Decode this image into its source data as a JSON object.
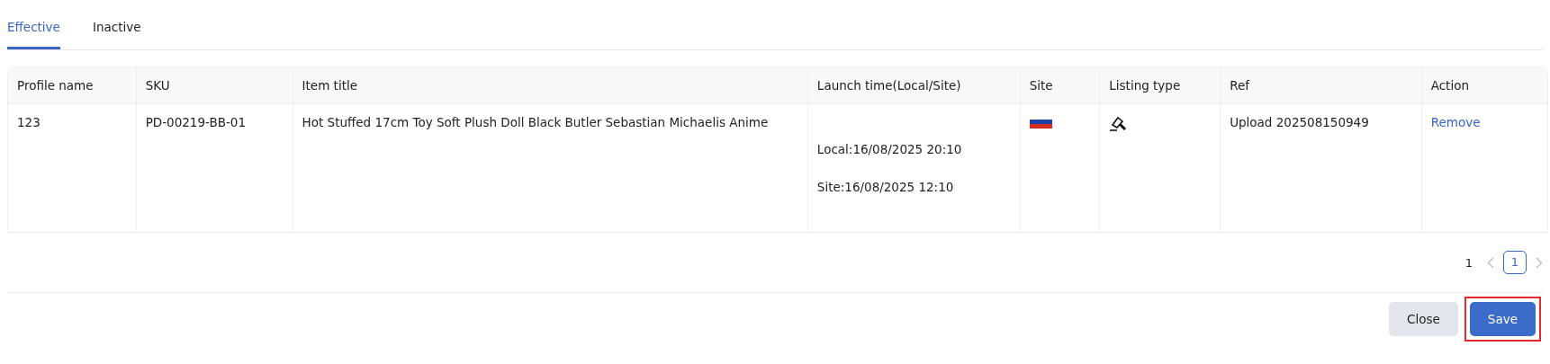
{
  "tabs": [
    {
      "label": "Effective",
      "selected": true
    },
    {
      "label": "Inactive",
      "selected": false
    }
  ],
  "table": {
    "columns": [
      "Profile name",
      "SKU",
      "Item title",
      "Launch time(Local/Site)",
      "Site",
      "Listing type",
      "Ref",
      "Action"
    ],
    "rows": [
      {
        "profile_name": "123",
        "sku": "PD-00219-BB-01",
        "item_title": "Hot Stuffed 17cm Toy Soft Plush Doll Black Butler Sebastian Michaelis Anime",
        "launch_local": "Local:16/08/2025 20:10",
        "launch_site": "Site:16/08/2025 12:10",
        "ref": "Upload 202508150949",
        "action": "Remove"
      }
    ]
  },
  "pagination": {
    "total": "1",
    "pages": [
      {
        "label": "1",
        "selected": true
      }
    ]
  },
  "buttons": [
    {
      "label": "Close",
      "kind": "secondary",
      "highlighted": false
    },
    {
      "label": "Save",
      "kind": "primary",
      "highlighted": true
    }
  ]
}
